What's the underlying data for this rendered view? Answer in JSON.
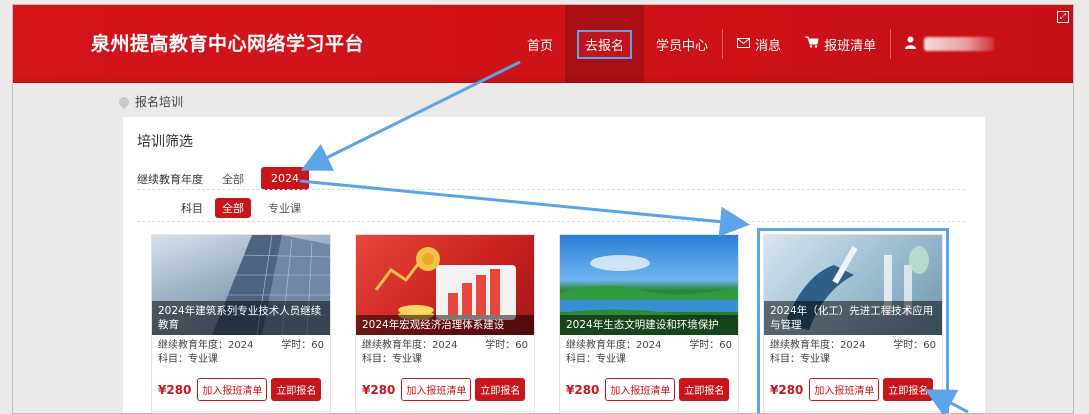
{
  "header": {
    "site_title": "泉州提高教育中心网络学习平台",
    "nav": [
      {
        "label": "首页"
      },
      {
        "label": "去报名"
      },
      {
        "label": "学员中心"
      },
      {
        "label": "消息"
      },
      {
        "label": "报班清单"
      }
    ]
  },
  "breadcrumb": {
    "label": "报名培训"
  },
  "filter": {
    "title": "培训筛选",
    "year_label": "继续教育年度",
    "year_options": [
      "全部",
      "2024"
    ],
    "year_selected": "2024",
    "subject_label": "科目",
    "subject_options": [
      "全部",
      "专业课"
    ],
    "subject_selected": "全部"
  },
  "courses": [
    {
      "title": "2024年建筑系列专业技术人员继续教育",
      "year_text": "继续教育年度：2024",
      "hours_text": "学时：60",
      "subject_text": "科目：专业课",
      "price": "¥280",
      "add_label": "加入报班清单",
      "enroll_label": "立即报名"
    },
    {
      "title": "2024年宏观经济治理体系建设",
      "year_text": "继续教育年度：2024",
      "hours_text": "学时：60",
      "subject_text": "科目：专业课",
      "price": "¥280",
      "add_label": "加入报班清单",
      "enroll_label": "立即报名"
    },
    {
      "title": "2024年生态文明建设和环境保护",
      "year_text": "继续教育年度：2024",
      "hours_text": "学时：60",
      "subject_text": "科目：专业课",
      "price": "¥280",
      "add_label": "加入报班清单",
      "enroll_label": "立即报名"
    },
    {
      "title": "2024年（化工）先进工程技术应用与管理",
      "year_text": "继续教育年度：2024",
      "hours_text": "学时：60",
      "subject_text": "科目：专业课",
      "price": "¥280",
      "add_label": "加入报班清单",
      "enroll_label": "立即报名"
    }
  ],
  "colors": {
    "brand_red": "#c9161c",
    "annotation_blue": "#5ba4e8"
  }
}
